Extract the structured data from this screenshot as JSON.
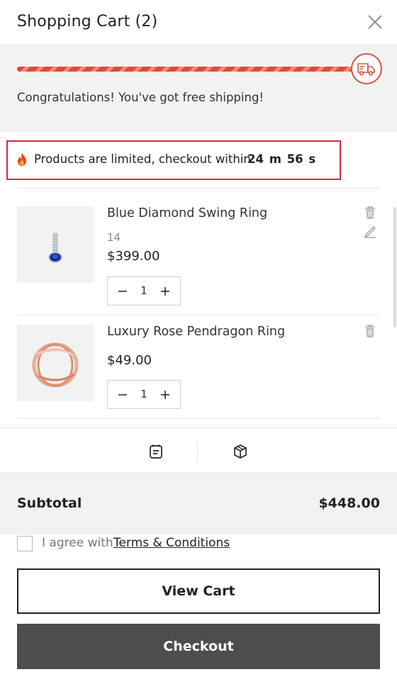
{
  "header": {
    "title": "Shopping Cart (2)",
    "close_icon": "close-icon"
  },
  "shipping": {
    "message": "Congratulations! You've got free shipping!",
    "progress": 1.0,
    "icon": "delivery-truck-icon",
    "accent_color": "#de4a3a"
  },
  "timer": {
    "text": "Products are limited, checkout within",
    "value": "24 m 56 s",
    "icon": "fire-icon",
    "highlight_color": "#d72b3c"
  },
  "items": [
    {
      "name": "Blue Diamond Swing Ring",
      "variant": "14",
      "price": "$399.00",
      "quantity": "1",
      "actions": [
        "trash-icon",
        "edit-icon"
      ]
    },
    {
      "name": "Luxury Rose Pendragon Ring",
      "price": "$49.00",
      "quantity": "1",
      "actions": [
        "trash-icon"
      ]
    }
  ],
  "tools": [
    "note-icon",
    "package-box-icon"
  ],
  "footer": {
    "subtotal_label": "Subtotal",
    "subtotal_value": "$448.00",
    "agree_text": "I agree with",
    "terms_link": "Terms & Conditions",
    "view_cart_label": "View Cart",
    "checkout_label": "Checkout",
    "checkout_color": "#4d4d4d"
  }
}
